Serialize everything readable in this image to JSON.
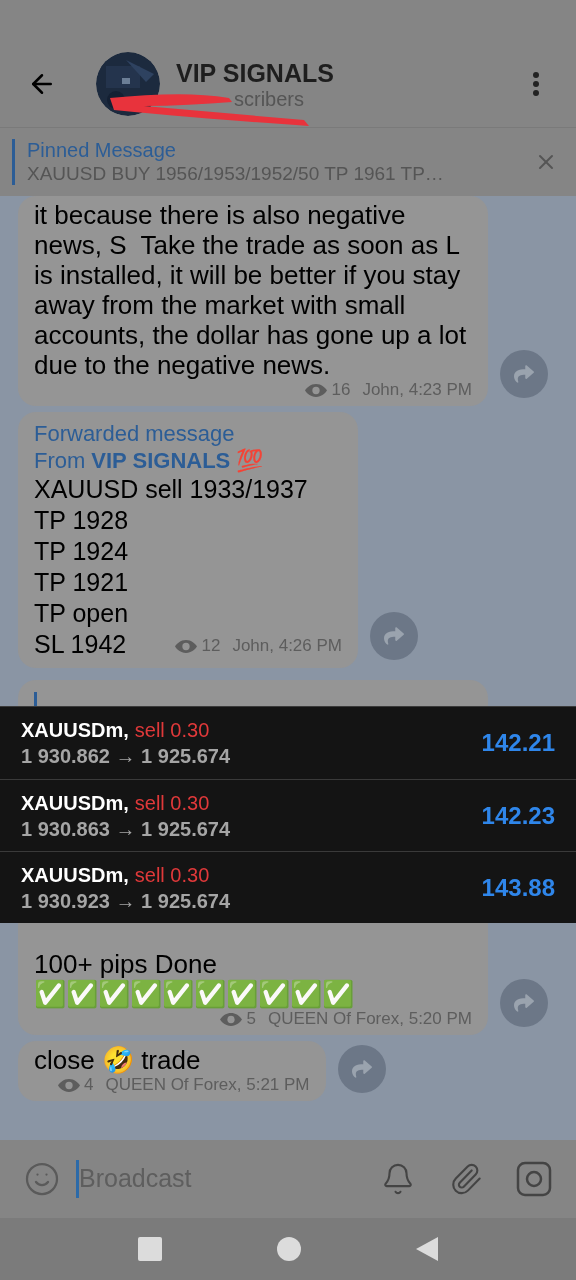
{
  "header": {
    "title": "VIP SIGNALS",
    "subtitle": "scribers"
  },
  "pinned": {
    "label": "Pinned Message",
    "text": "XAUUSD BUY 1956/1953/1952/50 TP 1961 TP…"
  },
  "messages_top": [
    {
      "kind": "text",
      "text": "it because there is also negative news, S  Take the trade as soon as L is installed, it will be better if you stay away from the market with small accounts, the dollar has gone up a lot due to the negative news.",
      "views": "16",
      "author": "John, 4:23 PM"
    },
    {
      "kind": "forwarded",
      "forward_label": "Forwarded message",
      "from_prefix": "From",
      "from": "VIP SIGNALS 💯",
      "lines": [
        "XAUUSD sell 1933/1937",
        "TP 1928",
        "TP 1924",
        "TP 1921",
        "TP open",
        "SL 1942"
      ],
      "views": "12",
      "author": "John, 4:26 PM"
    },
    {
      "kind": "quote_stub"
    }
  ],
  "trades": [
    {
      "symbol": "XAUUSDm,",
      "side": "sell 0.30",
      "prices": "1 930.862 → 1 925.674",
      "profit": "142.21"
    },
    {
      "symbol": "XAUUSDm,",
      "side": "sell 0.30",
      "prices": "1 930.863 → 1 925.674",
      "profit": "142.23"
    },
    {
      "symbol": "XAUUSDm,",
      "side": "sell 0.30",
      "prices": "1 930.923 → 1 925.674",
      "profit": "143.88"
    }
  ],
  "messages_bottom": [
    {
      "kind": "text",
      "text": "100+ pips Done ✅✅✅✅✅✅✅✅✅✅",
      "views": "5",
      "author": "QUEEN Of Forex, 5:20 PM",
      "cut_top": true
    },
    {
      "kind": "text",
      "text": "close 🤣 trade",
      "views": "4",
      "author": "QUEEN Of Forex, 5:21 PM"
    }
  ],
  "composer": {
    "placeholder": "Broadcast"
  }
}
